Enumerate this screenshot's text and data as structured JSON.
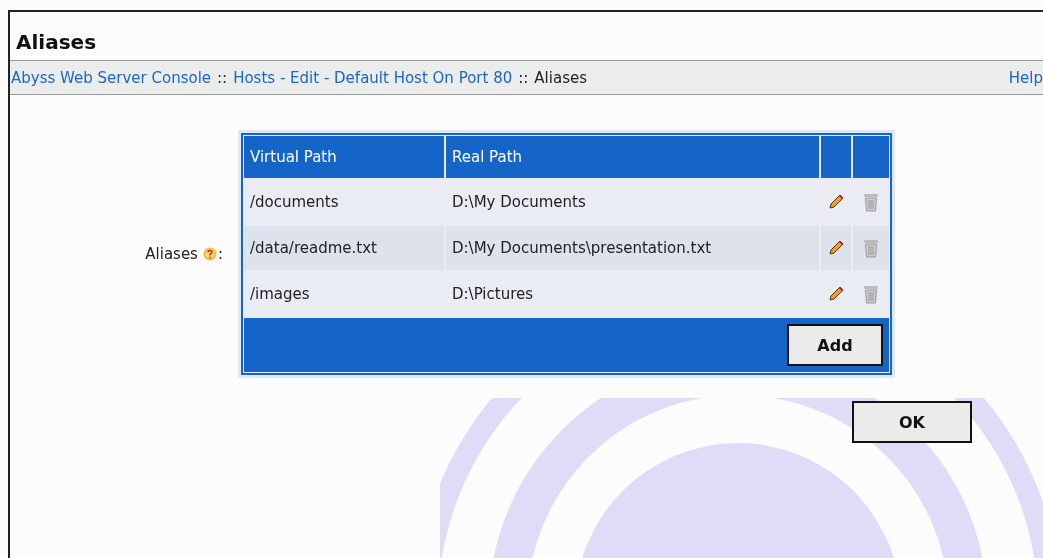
{
  "title": "Aliases",
  "breadcrumb": [
    {
      "kind": "link",
      "text": "Abyss Web Server Console"
    },
    {
      "kind": "separator",
      "text": "::"
    },
    {
      "kind": "link",
      "text": "Hosts - Edit - Default Host On Port 80"
    },
    {
      "kind": "separator",
      "text": "::"
    },
    {
      "kind": "current",
      "text": "Aliases"
    }
  ],
  "help": "Help",
  "field_label": "Aliases",
  "field_colon": ":",
  "table": {
    "columns": [
      "Virtual Path",
      "Real Path"
    ],
    "rows": [
      {
        "virtual_path": "/documents",
        "real_path": "D:\\My Documents"
      },
      {
        "virtual_path": "/data/readme.txt",
        "real_path": "D:\\My Documents\\presentation.txt"
      },
      {
        "virtual_path": "/images",
        "real_path": "D:\\Pictures"
      }
    ],
    "add_button": "Add"
  },
  "ok_button": "OK"
}
